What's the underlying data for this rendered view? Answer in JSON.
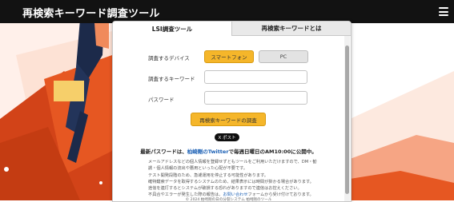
{
  "header": {
    "title": "再検索キーワード調査ツール"
  },
  "tabs": [
    {
      "label": "LSI調査ツール"
    },
    {
      "label": "再検索キーワードとは"
    }
  ],
  "form": {
    "device_label": "調査するデバイス",
    "device_options": [
      "スマートフォン",
      "PC"
    ],
    "device_selected": "スマートフォン",
    "keyword_label": "調査するキーワード",
    "keyword_value": "",
    "password_label": "パスワード",
    "password_value": "",
    "submit_label": "再検索キーワードの調査"
  },
  "share": {
    "x_post_label": "X ポスト"
  },
  "announcement": {
    "prefix": "最新パスワードは、",
    "link": "柏崎剛のTwitter",
    "suffix": "で毎週日曜日のAM10:00に公開中。"
  },
  "notes": {
    "line1": "メールアドレスなどの個人情報を登録せずともツールをご利用いただけますので、DM・勧",
    "line2": "誘・個人情報の流出や悪用といった心配が不要です。",
    "line3": "テスト開発段階のため、急遽運用を停止する可能性があります。",
    "line4": "確特鍵索データを取得するシステムのため、結果表示には時間が掛かる場合があります。",
    "line5": "途信を連打するとシステムが破損する恐れがありますので連信はお控えください。",
    "line6_prefix": "不具合やエラーが発生した際の報告は、",
    "line6_link": "お問い合わせ",
    "line6_suffix": "フォームから受け付けております。"
  },
  "footer": {
    "copyright": "© 2024 柏崎剛の日の分裂システム 柏崎剛のツール"
  },
  "colors": {
    "accent": "#f5b62a",
    "header_bg": "#121212",
    "link": "#1a5fb4"
  },
  "icons": {
    "menu": "hamburger-menu-icon"
  }
}
